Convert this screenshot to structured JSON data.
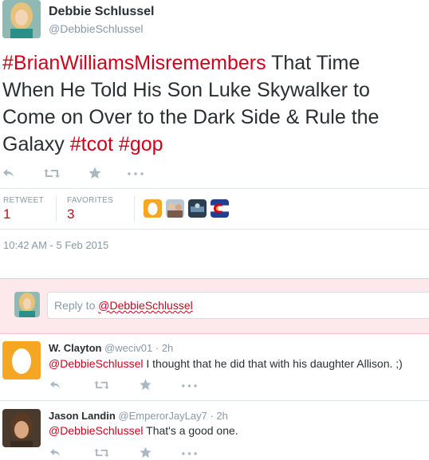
{
  "main_tweet": {
    "name": "Debbie Schlussel",
    "handle": "@DebbieSchlussel",
    "text_parts": {
      "hashtag1": "#BrianWilliamsMisremembers",
      "line1_rest": " That Time",
      "line2": "When He Told His Son Luke Skywalker to",
      "line3": "Come on Over to the Dark Side & Rule the",
      "line4_start": "Galaxy ",
      "hashtag2": "#tcot",
      "hashtag3": "#gop"
    },
    "stats": {
      "retweet_label": "RETWEET",
      "retweet_value": "1",
      "favorites_label": "FAVORITES",
      "favorites_value": "3"
    },
    "timestamp": "10:42 AM - 5 Feb 2015"
  },
  "reply_box": {
    "prefix": "Reply to ",
    "mention": "@DebbieSchlussel"
  },
  "replies": [
    {
      "name": "W. Clayton",
      "handle": "@weciv01",
      "time": "· 2h",
      "mention": "@DebbieSchlussel",
      "text": " I thought that he did that with his daughter Allison. ;)"
    },
    {
      "name": "Jason Landin",
      "handle": "@EmperorJayLay7",
      "time": "· 2h",
      "mention": "@DebbieSchlussel",
      "text": " That's a good one."
    }
  ],
  "icons": {
    "reply": "reply-icon",
    "retweet": "retweet-icon",
    "favorite": "star-icon",
    "more": "more-icon"
  },
  "colors": {
    "hashtag": "#d0021b",
    "reply_band": "#fde8ec",
    "muted": "#8899a6"
  }
}
